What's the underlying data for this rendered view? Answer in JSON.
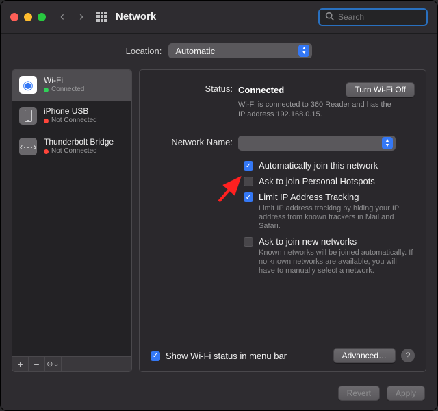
{
  "window": {
    "title": "Network"
  },
  "search": {
    "placeholder": "Search"
  },
  "location": {
    "label": "Location:",
    "value": "Automatic"
  },
  "sidebar": {
    "items": [
      {
        "name": "Wi-Fi",
        "status": "Connected",
        "connected": true
      },
      {
        "name": "iPhone USB",
        "status": "Not Connected",
        "connected": false
      },
      {
        "name": "Thunderbolt Bridge",
        "status": "Not Connected",
        "connected": false
      }
    ],
    "tools": {
      "add": "+",
      "remove": "−",
      "more": "⊙⌄"
    }
  },
  "content": {
    "status": {
      "label": "Status:",
      "value": "Connected",
      "btn": "Turn Wi-Fi Off",
      "detail": "Wi-Fi is connected to 360 Reader and has the IP address 192.168.0.15."
    },
    "network_name": {
      "label": "Network Name:"
    },
    "checks": {
      "auto_join": "Automatically join this network",
      "ask_hotspot": "Ask to join Personal Hotspots",
      "limit_ip": "Limit IP Address Tracking",
      "limit_ip_detail": "Limit IP address tracking by hiding your IP address from known trackers in Mail and Safari.",
      "ask_new": "Ask to join new networks",
      "ask_new_detail": "Known networks will be joined automatically. If no known networks are available, you will have to manually select a network."
    },
    "menubar": "Show Wi-Fi status in menu bar",
    "advanced": "Advanced…",
    "help": "?"
  },
  "footer": {
    "revert": "Revert",
    "apply": "Apply"
  }
}
